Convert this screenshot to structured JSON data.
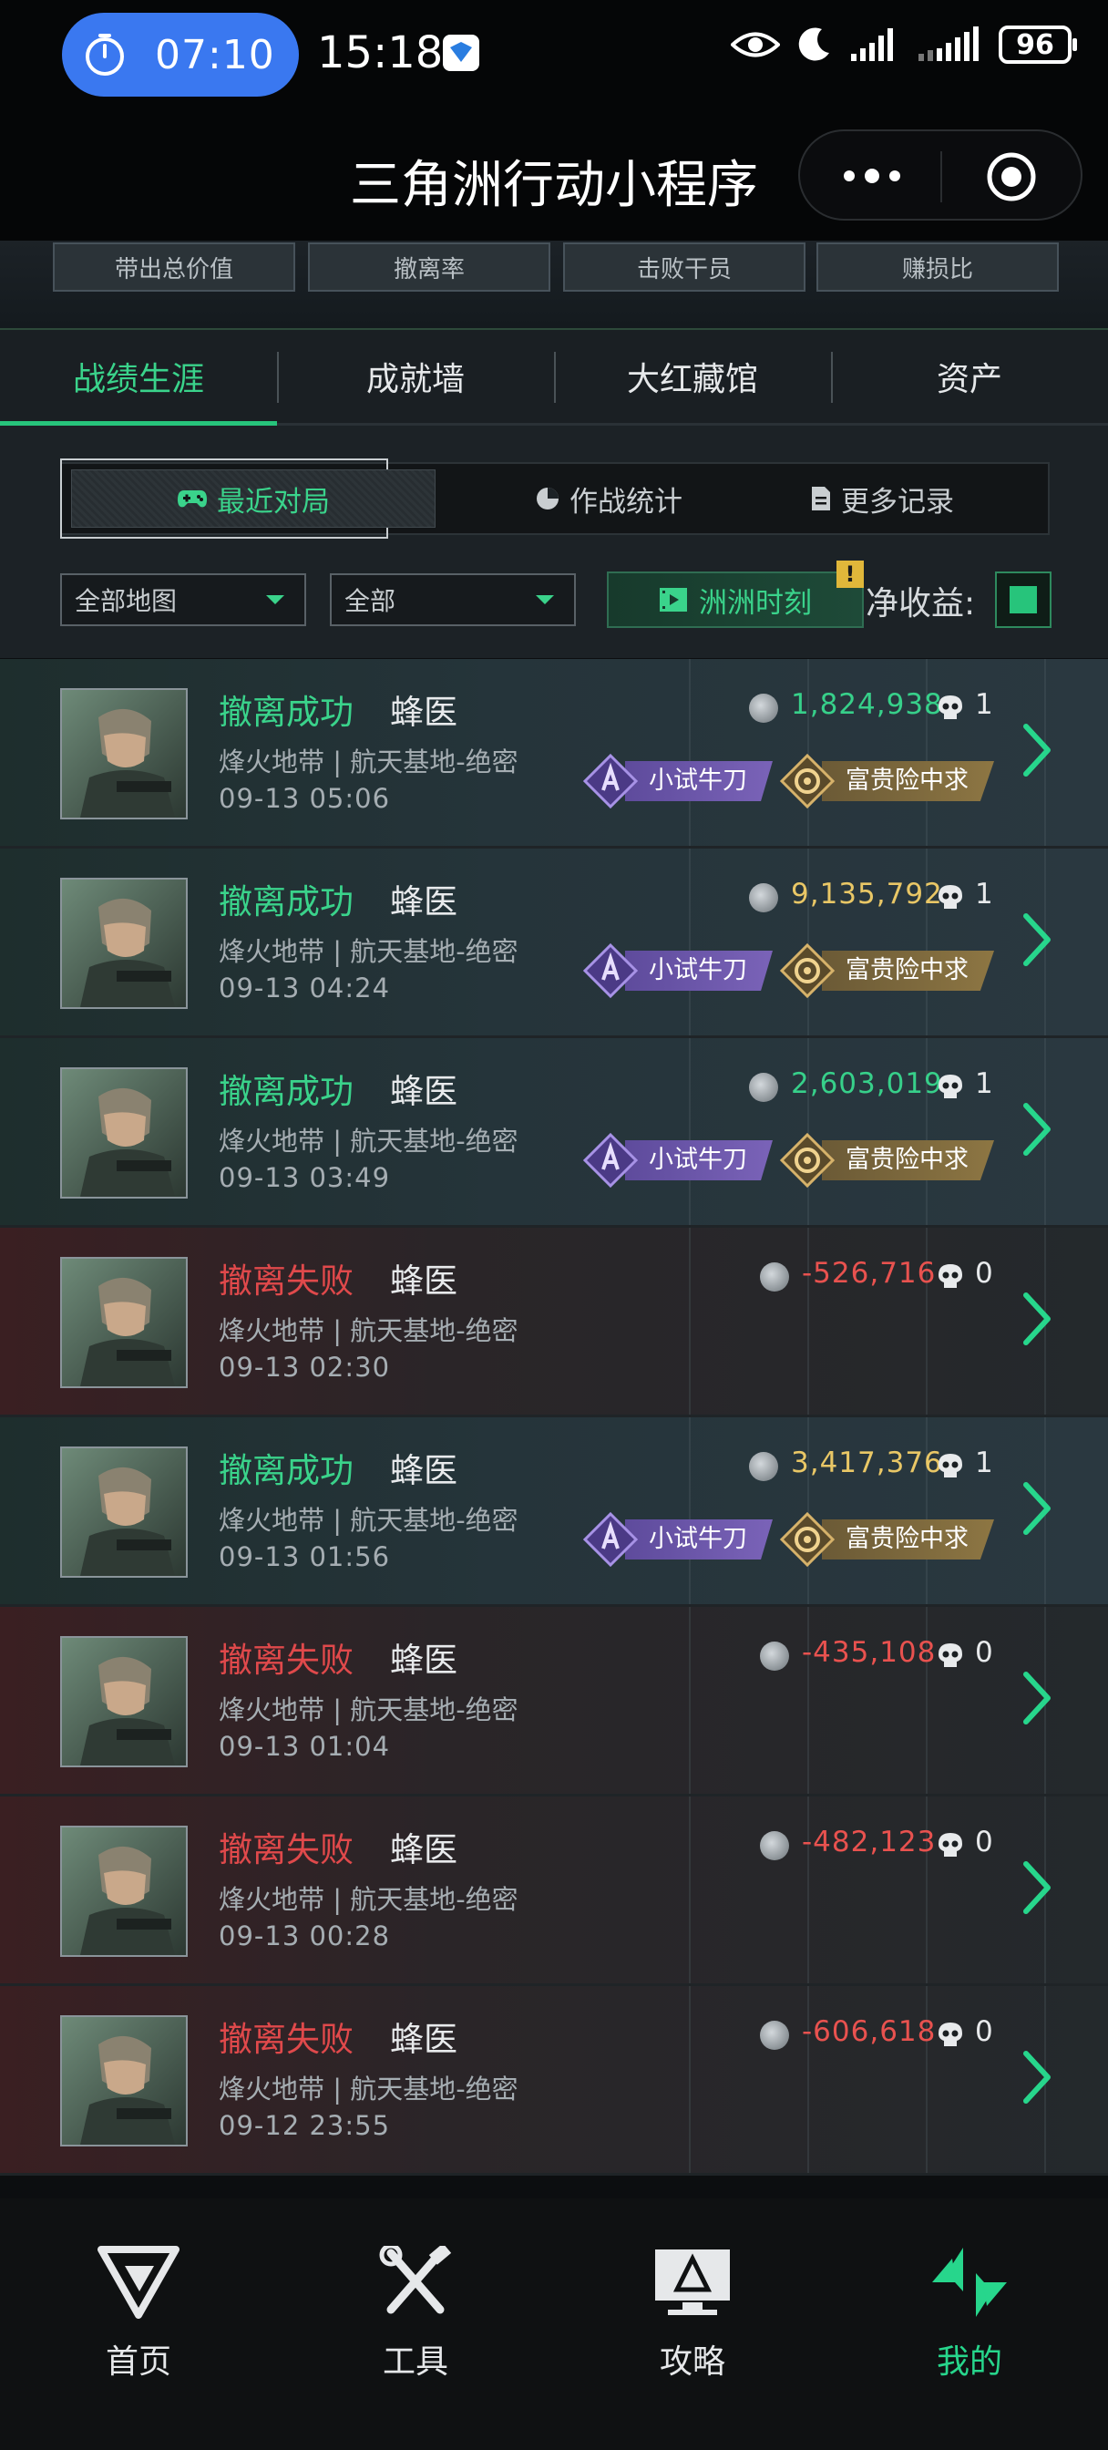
{
  "status_bar": {
    "timer": "07:10",
    "time": "15:18",
    "battery": "96"
  },
  "title_bar": {
    "title": "三角洲行动小程序"
  },
  "stats_strip": {
    "items": [
      "带出总价值",
      "撤离率",
      "击败干员",
      "赚损比"
    ]
  },
  "main_tabs": {
    "items": [
      "战绩生涯",
      "成就墙",
      "大红藏馆",
      "资产"
    ],
    "active": 0
  },
  "sub_tabs": {
    "items": [
      "最近对局",
      "作战统计",
      "更多记录"
    ],
    "active": 0
  },
  "filters": {
    "map": "全部地图",
    "mode": "全部",
    "moment_button": "洲洲时刻",
    "warning": "!",
    "net_income_label": "净收益:"
  },
  "matches": [
    {
      "status": "撤离成功",
      "result": "success",
      "operator": "蜂医",
      "map": "烽火地带 | 航天基地-绝密",
      "date": "09-13 05:06",
      "value": "1,824,938",
      "value_color": "green",
      "kills": "1",
      "badges": [
        "小试牛刀",
        "富贵险中求"
      ]
    },
    {
      "status": "撤离成功",
      "result": "success",
      "operator": "蜂医",
      "map": "烽火地带 | 航天基地-绝密",
      "date": "09-13 04:24",
      "value": "9,135,792",
      "value_color": "gold",
      "kills": "1",
      "badges": [
        "小试牛刀",
        "富贵险中求"
      ]
    },
    {
      "status": "撤离成功",
      "result": "success",
      "operator": "蜂医",
      "map": "烽火地带 | 航天基地-绝密",
      "date": "09-13 03:49",
      "value": "2,603,019",
      "value_color": "green",
      "kills": "1",
      "badges": [
        "小试牛刀",
        "富贵险中求"
      ]
    },
    {
      "status": "撤离失败",
      "result": "fail",
      "operator": "蜂医",
      "map": "烽火地带 | 航天基地-绝密",
      "date": "09-13 02:30",
      "value": "-526,716",
      "value_color": "red",
      "kills": "0",
      "badges": []
    },
    {
      "status": "撤离成功",
      "result": "success",
      "operator": "蜂医",
      "map": "烽火地带 | 航天基地-绝密",
      "date": "09-13 01:56",
      "value": "3,417,376",
      "value_color": "gold",
      "kills": "1",
      "badges": [
        "小试牛刀",
        "富贵险中求"
      ]
    },
    {
      "status": "撤离失败",
      "result": "fail",
      "operator": "蜂医",
      "map": "烽火地带 | 航天基地-绝密",
      "date": "09-13 01:04",
      "value": "-435,108",
      "value_color": "red",
      "kills": "0",
      "badges": []
    },
    {
      "status": "撤离失败",
      "result": "fail",
      "operator": "蜂医",
      "map": "烽火地带 | 航天基地-绝密",
      "date": "09-13 00:28",
      "value": "-482,123",
      "value_color": "red",
      "kills": "0",
      "badges": []
    },
    {
      "status": "撤离失败",
      "result": "fail",
      "operator": "蜂医",
      "map": "烽火地带 | 航天基地-绝密",
      "date": "09-12 23:55",
      "value": "-606,618",
      "value_color": "red",
      "kills": "0",
      "badges": []
    }
  ],
  "bottom_nav": {
    "items": [
      {
        "label": "首页",
        "icon": "home-logo-icon"
      },
      {
        "label": "工具",
        "icon": "tools-icon"
      },
      {
        "label": "攻略",
        "icon": "guide-monitor-icon"
      },
      {
        "label": "我的",
        "icon": "profile-logo-icon"
      }
    ],
    "active": 3
  },
  "colors": {
    "accent_green": "#27c47b",
    "success_text": "#3ad38b",
    "fail_text": "#e0494b",
    "gold_value": "#e9c766",
    "timer_blue": "#3a78f0"
  }
}
